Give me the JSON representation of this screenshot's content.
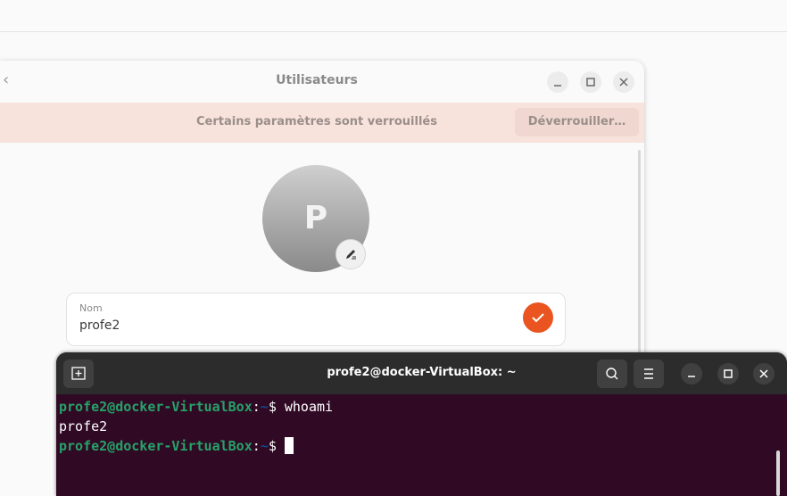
{
  "users_dialog": {
    "title": "Utilisateurs",
    "locked_message": "Certains paramètres sont verrouillés",
    "unlock_label": "Déverrouiller…",
    "avatar_initial": "P",
    "name_field": {
      "label": "Nom",
      "value": "profe2"
    },
    "accent_color": "#e95420"
  },
  "terminal": {
    "title": "profe2@docker-VirtualBox: ~",
    "lines": [
      {
        "user_host": "profe2@docker-VirtualBox",
        "path": "~",
        "symbol": "$",
        "command": "whoami"
      },
      {
        "output": "profe2"
      },
      {
        "user_host": "profe2@docker-VirtualBox",
        "path": "~",
        "symbol": "$",
        "command": ""
      }
    ],
    "background_color": "#300a24"
  }
}
